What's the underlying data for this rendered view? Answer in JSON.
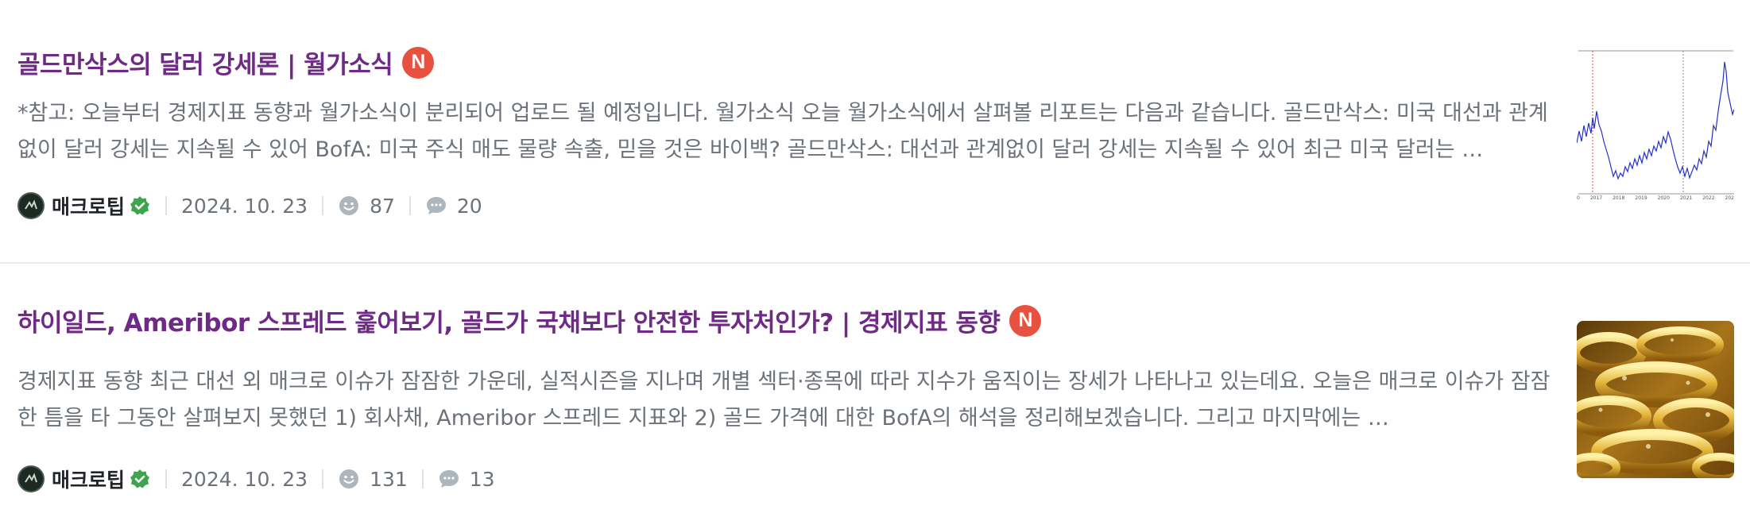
{
  "articles": [
    {
      "title": "골드만삭스의 달러 강세론 | 월가소식",
      "badge": "N",
      "excerpt": "*참고: 오늘부터 경제지표 동향과 월가소식이 분리되어 업로드 될 예정입니다. 월가소식 오늘 월가소식에서 살펴볼 리포트는 다음과 같습니다. 골드만삭스: 미국 대선과 관계없이 달러 강세는 지속될 수 있어 BofA: 미국 주식 매도 물량 속출, 믿을 것은 바이백? 골드만삭스: 대선과 관계없이 달러 강세는 지속될 수 있어 최근 미국 달러는 …",
      "author": "매크로팁",
      "date": "2024. 10. 23",
      "likes": "87",
      "comments": "20",
      "thumb_axis_labels": [
        "0",
        "2017",
        "2018",
        "2019",
        "2020",
        "2021",
        "2022",
        "202"
      ]
    },
    {
      "title": "하이일드, Ameribor 스프레드 훑어보기, 골드가 국채보다 안전한 투자처인가? | 경제지표 동향",
      "badge": "N",
      "excerpt": "경제지표 동향 최근 대선 외 매크로 이슈가 잠잠한 가운데, 실적시즌을 지나며 개별 섹터·종목에 따라 지수가 움직이는 장세가 나타나고 있는데요. 오늘은 매크로 이슈가 잠잠한 틈을 타 그동안 살펴보지 못했던 1) 회사채, Ameribor 스프레드 지표와 2) 골드 가격에 대한 BofA의 해석을 정리해보겠습니다. 그리고 마지막에는 …",
      "author": "매크로팁",
      "date": "2024. 10. 23",
      "likes": "131",
      "comments": "13"
    }
  ],
  "colors": {
    "title": "#6f2a85",
    "badge": "#e8503f",
    "verified": "#3fa350",
    "meta_text": "#6c727a"
  },
  "icons": {
    "badge": "new-badge",
    "verified": "verified-check-icon",
    "likes": "smiley-icon",
    "comments": "comment-bubble-icon"
  }
}
